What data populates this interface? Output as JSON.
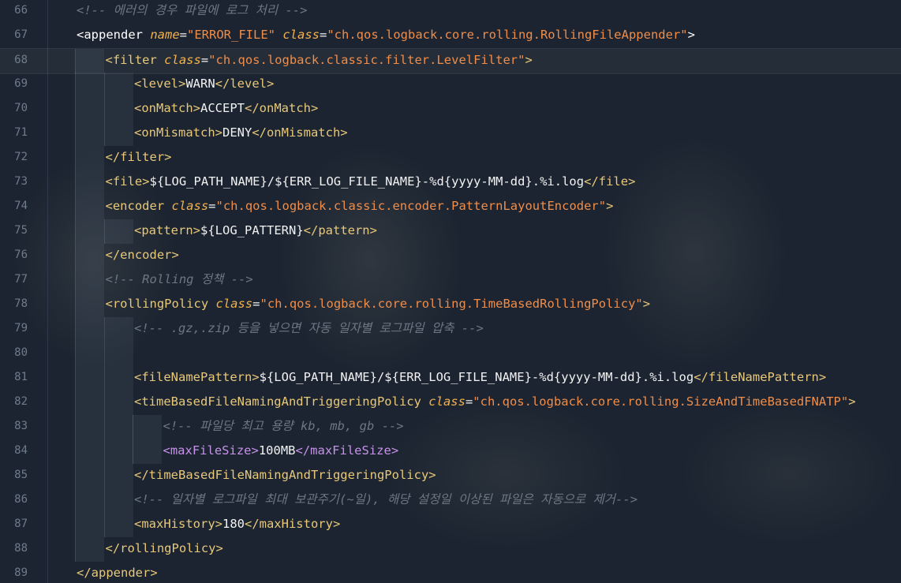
{
  "editor": {
    "colors": {
      "background": "#1b2430",
      "tag": "#e8c879",
      "attribute": "#f3b24c",
      "value": "#f08d49",
      "text": "#f2f2f2",
      "comment": "#6d7784",
      "line_number": "#6f7c8c"
    },
    "lines": [
      {
        "number": "66",
        "tokens": [
          {
            "text": "<!-- 에러의 경우 파일에 로그 처리 -->",
            "type": "c"
          }
        ]
      },
      {
        "number": "67",
        "tokens": [
          {
            "text": "<appender ",
            "type": "tb"
          },
          {
            "text": "name",
            "type": "a"
          },
          {
            "text": "=",
            "type": "x"
          },
          {
            "text": "\"ERROR_FILE\" ",
            "type": "v"
          },
          {
            "text": "class",
            "type": "a"
          },
          {
            "text": "=",
            "type": "x"
          },
          {
            "text": "\"ch.qos.logback.core.rolling.RollingFileAppender\"",
            "type": "v"
          },
          {
            "text": ">",
            "type": "tb"
          }
        ]
      },
      {
        "number": "68",
        "tokens": [
          {
            "text": "<filter ",
            "type": "t"
          },
          {
            "text": "class",
            "type": "a"
          },
          {
            "text": "=",
            "type": "x"
          },
          {
            "text": "\"ch.qos.logback.classic.filter.LevelFilter\"",
            "type": "v"
          },
          {
            "text": ">",
            "type": "t"
          }
        ]
      },
      {
        "number": "69",
        "tokens": [
          {
            "text": "<level>",
            "type": "t"
          },
          {
            "text": "WARN",
            "type": "x"
          },
          {
            "text": "</level>",
            "type": "t"
          }
        ]
      },
      {
        "number": "70",
        "tokens": [
          {
            "text": "<onMatch>",
            "type": "t"
          },
          {
            "text": "ACCEPT",
            "type": "x"
          },
          {
            "text": "</onMatch>",
            "type": "t"
          }
        ]
      },
      {
        "number": "71",
        "tokens": [
          {
            "text": "<onMismatch>",
            "type": "t"
          },
          {
            "text": "DENY",
            "type": "x"
          },
          {
            "text": "</onMismatch>",
            "type": "t"
          }
        ]
      },
      {
        "number": "72",
        "tokens": [
          {
            "text": "</filter>",
            "type": "t"
          }
        ]
      },
      {
        "number": "73",
        "tokens": [
          {
            "text": "<file>",
            "type": "t"
          },
          {
            "text": "${LOG_PATH_NAME}/${ERR_LOG_FILE_NAME}-%d{yyyy-MM-dd}.%i.log",
            "type": "x"
          },
          {
            "text": "</file>",
            "type": "t"
          }
        ]
      },
      {
        "number": "74",
        "tokens": [
          {
            "text": "<encoder ",
            "type": "t"
          },
          {
            "text": "class",
            "type": "a"
          },
          {
            "text": "=",
            "type": "x"
          },
          {
            "text": "\"ch.qos.logback.classic.encoder.PatternLayoutEncoder\"",
            "type": "v"
          },
          {
            "text": ">",
            "type": "t"
          }
        ]
      },
      {
        "number": "75",
        "tokens": [
          {
            "text": "<pattern>",
            "type": "t"
          },
          {
            "text": "${LOG_PATTERN}",
            "type": "x"
          },
          {
            "text": "</pattern>",
            "type": "t"
          }
        ]
      },
      {
        "number": "76",
        "tokens": [
          {
            "text": "</encoder>",
            "type": "t"
          }
        ]
      },
      {
        "number": "77",
        "tokens": [
          {
            "text": "<!-- Rolling 정책 -->",
            "type": "c"
          }
        ]
      },
      {
        "number": "78",
        "tokens": [
          {
            "text": "<rollingPolicy ",
            "type": "t"
          },
          {
            "text": "class",
            "type": "a"
          },
          {
            "text": "=",
            "type": "x"
          },
          {
            "text": "\"ch.qos.logback.core.rolling.TimeBasedRollingPolicy\"",
            "type": "v"
          },
          {
            "text": ">",
            "type": "t"
          }
        ]
      },
      {
        "number": "79",
        "tokens": [
          {
            "text": "<!-- .gz,.zip 등을 넣으면 자동 일자별 로그파일 압축 -->",
            "type": "c"
          }
        ]
      },
      {
        "number": "80",
        "tokens": []
      },
      {
        "number": "81",
        "tokens": [
          {
            "text": "<fileNamePattern>",
            "type": "t"
          },
          {
            "text": "${LOG_PATH_NAME}/${ERR_LOG_FILE_NAME}-%d{yyyy-MM-dd}.%i.log",
            "type": "x"
          },
          {
            "text": "</fileNamePattern>",
            "type": "t"
          }
        ]
      },
      {
        "number": "82",
        "tokens": [
          {
            "text": "<timeBasedFileNamingAndTriggeringPolicy ",
            "type": "t"
          },
          {
            "text": "class",
            "type": "a"
          },
          {
            "text": "=",
            "type": "x"
          },
          {
            "text": "\"ch.qos.logback.core.rolling.SizeAndTimeBasedFNATP\"",
            "type": "v"
          },
          {
            "text": ">",
            "type": "t"
          }
        ]
      },
      {
        "number": "83",
        "tokens": [
          {
            "text": "<!-- 파일당 최고 용량 kb, mb, gb -->",
            "type": "c"
          }
        ]
      },
      {
        "number": "84",
        "tokens": [
          {
            "text": "<maxFileSize>",
            "type": "tp"
          },
          {
            "text": "100MB",
            "type": "x"
          },
          {
            "text": "</maxFileSize>",
            "type": "tp"
          }
        ]
      },
      {
        "number": "85",
        "tokens": [
          {
            "text": "</timeBasedFileNamingAndTriggeringPolicy>",
            "type": "t"
          }
        ]
      },
      {
        "number": "86",
        "tokens": [
          {
            "text": "<!-- 일자별 로그파일 최대 보관주기(~일), 해당 설정일 이상된 파일은 자동으로 제거-->",
            "type": "c"
          }
        ]
      },
      {
        "number": "87",
        "tokens": [
          {
            "text": "<maxHistory>",
            "type": "t"
          },
          {
            "text": "180",
            "type": "x"
          },
          {
            "text": "</maxHistory>",
            "type": "t"
          }
        ]
      },
      {
        "number": "88",
        "tokens": [
          {
            "text": "</rollingPolicy>",
            "type": "t"
          }
        ]
      },
      {
        "number": "89",
        "tokens": [
          {
            "text": "</appender>",
            "type": "t"
          }
        ]
      }
    ]
  }
}
